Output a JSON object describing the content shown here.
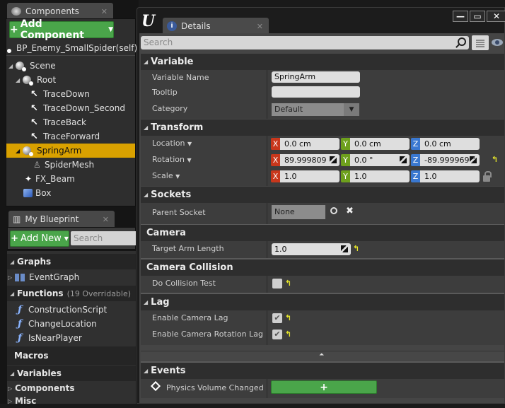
{
  "components_panel": {
    "tab_label": "Components",
    "add_button": "Add Component",
    "self_item": "BP_Enemy_SmallSpider(self)",
    "tree": [
      {
        "label": "Scene",
        "icon": "scene-icon",
        "depth": 0,
        "expanded": true
      },
      {
        "label": "Root",
        "icon": "scene-icon",
        "depth": 1,
        "expanded": true
      },
      {
        "label": "TraceDown",
        "icon": "arrow-component-icon",
        "depth": 2
      },
      {
        "label": "TraceDown_Second",
        "icon": "arrow-component-icon",
        "depth": 2
      },
      {
        "label": "TraceBack",
        "icon": "arrow-component-icon",
        "depth": 2
      },
      {
        "label": "TraceForward",
        "icon": "arrow-component-icon",
        "depth": 2
      },
      {
        "label": "SpringArm",
        "icon": "scene-icon",
        "depth": 1,
        "expanded": true,
        "selected": true
      },
      {
        "label": "SpiderMesh",
        "icon": "skeletal-mesh-icon",
        "depth": 2
      },
      {
        "label": "FX_Beam",
        "icon": "particle-icon",
        "depth": 1
      },
      {
        "label": "Box",
        "icon": "box-icon",
        "depth": 1
      }
    ]
  },
  "blueprint_panel": {
    "tab_label": "My Blueprint",
    "add_button": "Add New",
    "search_placeholder": "Search",
    "graphs_header": "Graphs",
    "graphs": [
      "EventGraph"
    ],
    "functions_header": "Functions",
    "functions_count": "(19 Overridable)",
    "functions": [
      "ConstructionScript",
      "ChangeLocation",
      "IsNearPlayer"
    ],
    "macros_header": "Macros",
    "variables_header": "Variables",
    "variable_groups": [
      "Components",
      "Misc"
    ]
  },
  "details": {
    "tab_label": "Details",
    "search_placeholder": "Search",
    "window_buttons": {
      "minimize": "—",
      "maximize": "▭",
      "close": "✕"
    },
    "sections": {
      "variable": {
        "title": "Variable",
        "variable_name_label": "Variable Name",
        "variable_name_value": "SpringArm",
        "tooltip_label": "Tooltip",
        "tooltip_value": "",
        "category_label": "Category",
        "category_value": "Default"
      },
      "transform": {
        "title": "Transform",
        "location_label": "Location",
        "rotation_label": "Rotation",
        "scale_label": "Scale",
        "location": {
          "x": "0.0 cm",
          "y": "0.0 cm",
          "z": "0.0 cm"
        },
        "rotation": {
          "x": "89.999809 °",
          "y": "0.0 °",
          "z": "-89.999969 °"
        },
        "scale": {
          "x": "1.0",
          "y": "1.0",
          "z": "1.0"
        }
      },
      "sockets": {
        "title": "Sockets",
        "parent_socket_label": "Parent Socket",
        "parent_socket_value": "None"
      },
      "camera": {
        "title": "Camera",
        "target_arm_length_label": "Target Arm Length",
        "target_arm_length_value": "1.0"
      },
      "camera_collision": {
        "title": "Camera Collision",
        "do_collision_test_label": "Do Collision Test",
        "do_collision_test_value": false
      },
      "lag": {
        "title": "Lag",
        "enable_camera_lag_label": "Enable Camera Lag",
        "enable_camera_lag_value": true,
        "enable_camera_rotation_lag_label": "Enable Camera Rotation Lag",
        "enable_camera_rotation_lag_value": true
      },
      "events": {
        "title": "Events",
        "physics_volume_changed_label": "Physics Volume Changed",
        "add_event_button": "+"
      }
    },
    "axis_labels": {
      "x": "X",
      "y": "Y",
      "z": "Z"
    }
  },
  "colors": {
    "selection": "#d9a100",
    "green_button": "#4aa54a",
    "axis_x": "#c8371c",
    "axis_y": "#6ea01d",
    "axis_z": "#3a78d0",
    "reset_arrow": "#e8e82a"
  }
}
